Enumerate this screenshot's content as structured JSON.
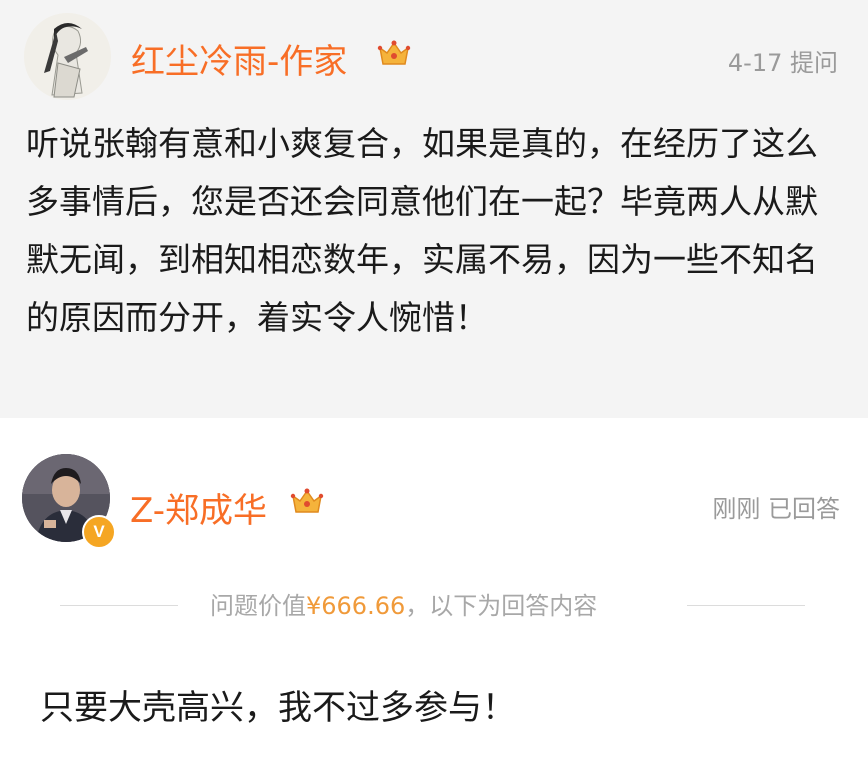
{
  "question": {
    "username": "红尘冷雨-作家",
    "meta": "4-17 提问",
    "text": "听说张翰有意和小爽复合，如果是真的，在经历了这么多事情后，您是否还会同意他们在一起？毕竟两人从默默无闻，到相知相恋数年，实属不易，因为一些不知名的原因而分开，着实令人惋惜！"
  },
  "answer": {
    "username": "Z-郑成华",
    "meta": "刚刚 已回答",
    "verified_badge": "V",
    "price_prefix": "问题价值",
    "price_amount": "¥666.66",
    "price_suffix": "，以下为回答内容",
    "text": "只要大壳高兴，我不过多参与！"
  },
  "colors": {
    "username": "#f86e26",
    "price": "#f09a3a",
    "meta": "#9a9a9a"
  }
}
